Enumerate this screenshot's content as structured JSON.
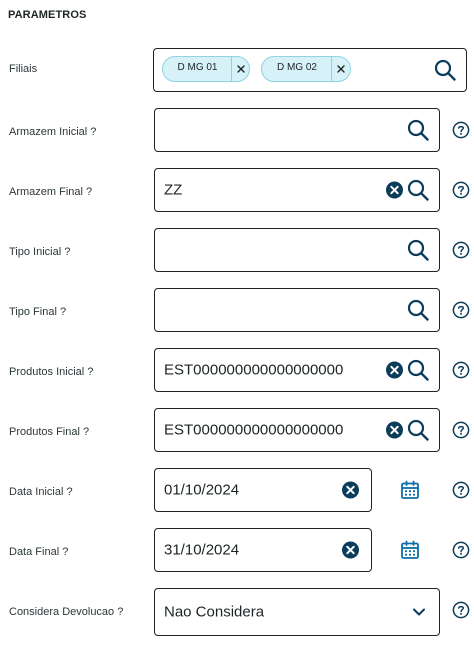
{
  "section_title": "PARAMETROS",
  "fields": {
    "filiais": {
      "label": "Filiais",
      "chips": [
        "D MG 01",
        "D MG 02"
      ]
    },
    "armazem_inicial": {
      "label": "Armazem Inicial ?",
      "value": ""
    },
    "armazem_final": {
      "label": "Armazem Final ?",
      "value": "ZZ"
    },
    "tipo_inicial": {
      "label": "Tipo Inicial ?",
      "value": ""
    },
    "tipo_final": {
      "label": "Tipo Final ?",
      "value": ""
    },
    "produtos_inicial": {
      "label": "Produtos Inicial ?",
      "value": "EST000000000000000000"
    },
    "produtos_final": {
      "label": "Produtos Final ?",
      "value": "EST000000000000000000"
    },
    "data_inicial": {
      "label": "Data Inicial ?",
      "value": "01/10/2024"
    },
    "data_final": {
      "label": "Data Final ?",
      "value": "31/10/2024"
    },
    "considera_devolucao": {
      "label": "Considera Devolucao ?",
      "value": "Nao Considera"
    }
  },
  "icons": {
    "search": "search-icon",
    "clear": "clear-icon",
    "help": "help-icon",
    "calendar": "calendar-icon",
    "dropdown": "chevron-down-icon",
    "chip_close": "close-icon"
  },
  "colors": {
    "border": "#1d2426",
    "icon": "#0c3c5b",
    "calendar": "#0c6fa8",
    "chip_bg": "#d6f1f7",
    "chip_border": "#8fd3e4"
  }
}
